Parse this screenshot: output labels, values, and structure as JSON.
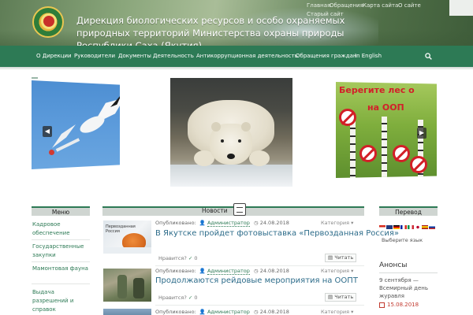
{
  "header": {
    "title": "Дирекция биологических ресурсов и особо охраняемых природных территорий Министерства охраны природы Республики Саха (Якутия)",
    "top_links": [
      "Главная",
      "Обращения",
      "Карта сайта",
      "О сайте",
      "Старый сайт"
    ]
  },
  "nav": {
    "items": [
      "О Дирекции",
      "Руководители",
      "Документы",
      "Деятельность",
      "Антикоррупционная деятельность",
      "Обращения граждан",
      "In English"
    ],
    "search_icon": "search-icon"
  },
  "slider": {
    "right_slide_title_line1": "Берегите лес о",
    "right_slide_title_line2": "на ООП",
    "prev_arrow": "◀",
    "next_arrow": "▶"
  },
  "menu": {
    "title": "Меню",
    "items": [
      "Кадровое обеспечение",
      "Государственные закупки",
      "Мамонтовая фауна",
      "Выдача разрешений и справок"
    ]
  },
  "news": {
    "title": "Новости",
    "items": [
      {
        "published_label": "Опубликовано:",
        "author": "Администратор",
        "date": "24.08.2018",
        "category_label": "Категория",
        "title": "В Якутске пройдет фотовыставка «Первозданная Россия»",
        "likes_label": "Нравится?",
        "likes_count": "0",
        "read_label": "Читать",
        "thumb_caption": "Первозданная Россия"
      },
      {
        "published_label": "Опубликовано:",
        "author": "Администратор",
        "date": "24.08.2018",
        "category_label": "Категория",
        "title": "Продолжаются рейдовые мероприятия на ООПТ",
        "likes_label": "Нравится?",
        "likes_count": "0",
        "read_label": "Читать"
      },
      {
        "published_label": "Опубликовано:",
        "author": "Администратор",
        "date": "24.08.2018",
        "category_label": "Категория"
      }
    ]
  },
  "translate": {
    "title": "Перевод",
    "select_placeholder": "Выберите язык"
  },
  "announcements": {
    "title": "Анонсы",
    "text": "9 сентября — Всемирный день журавля",
    "date": "15.08.2018"
  },
  "colors": {
    "brand_green": "#2d7a55",
    "link_blue": "#2d6c8a",
    "date_red": "#c23a2f"
  }
}
